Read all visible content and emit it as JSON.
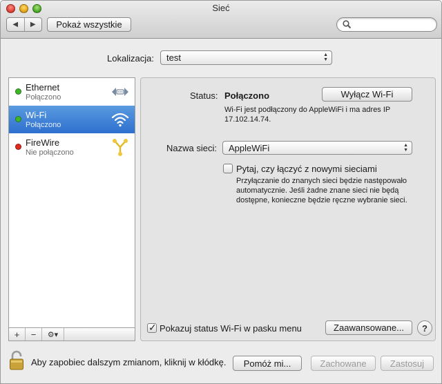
{
  "window": {
    "title": "Sieć"
  },
  "toolbar": {
    "back": "◀",
    "forward": "▶",
    "show_all": "Pokaż wszystkie",
    "search_placeholder": ""
  },
  "location": {
    "label": "Lokalizacja:",
    "value": "test"
  },
  "services": [
    {
      "name": "Ethernet",
      "status": "Połączono",
      "status_color": "#3fb52a",
      "icon": "ethernet-icon"
    },
    {
      "name": "Wi-Fi",
      "status": "Połączono",
      "status_color": "#3fb52a",
      "icon": "wifi-icon"
    },
    {
      "name": "FireWire",
      "status": "Nie połączono",
      "status_color": "#e02b20",
      "icon": "firewire-icon"
    }
  ],
  "sidebar_buttons": {
    "add": "+",
    "remove": "−",
    "action": "⚙▾"
  },
  "detail": {
    "status_label": "Status:",
    "status_value": "Połączono",
    "toggle_button": "Wyłącz Wi-Fi",
    "status_desc_1": "Wi-Fi jest podłączony do AppleWiFi i ma adres IP",
    "status_desc_2": "17.102.14.74.",
    "network_label": "Nazwa sieci:",
    "network_value": "AppleWiFi",
    "ask_label": "Pytaj, czy łączyć z nowymi sieciami",
    "ask_checked": false,
    "ask_desc_1": "Przyłączanie do znanych sieci będzie następowało",
    "ask_desc_2": "automatycznie. Jeśli żadne znane sieci nie będą",
    "ask_desc_3": "dostępne, konieczne będzie ręczne wybranie sieci.",
    "menu_status_label": "Pokazuj status Wi-Fi w pasku menu",
    "menu_status_checked": true,
    "advanced_button": "Zaawansowane...",
    "help_button": "?"
  },
  "footer": {
    "lock_text": "Aby zapobiec dalszym zmianom, kliknij w kłódkę.",
    "assist_button": "Pomóż mi...",
    "revert_button": "Zachowane",
    "apply_button": "Zastosuj"
  },
  "colors": {
    "selection": "#2e6fcf",
    "status_green": "#3fb52a",
    "status_red": "#e02b20"
  }
}
